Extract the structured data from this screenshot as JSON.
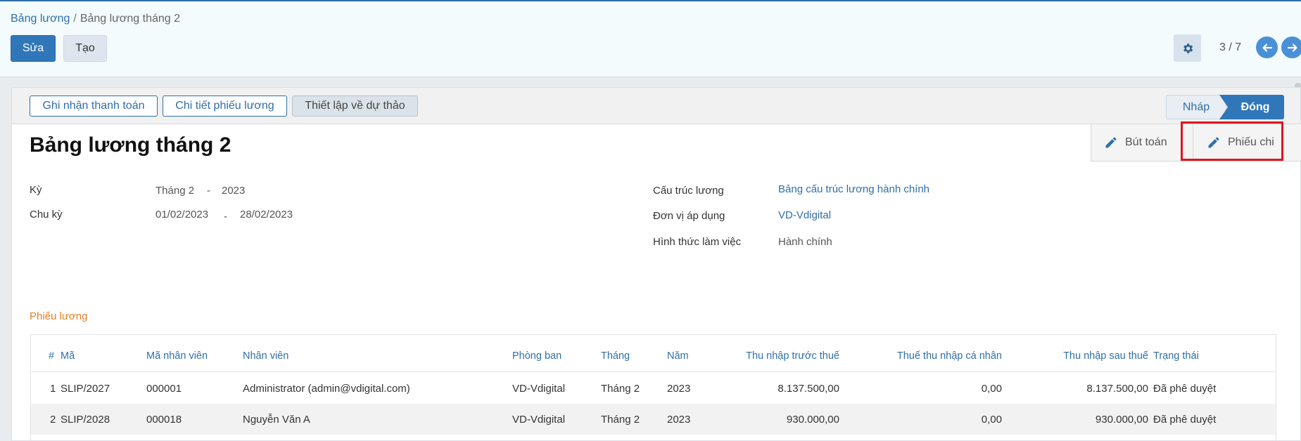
{
  "breadcrumb": {
    "parent": "Bảng lương",
    "separator": "/",
    "current": "Bảng lương tháng 2"
  },
  "actions": {
    "edit": "Sửa",
    "create": "Tạo"
  },
  "pager": {
    "text": "3 / 7"
  },
  "status_buttons": {
    "record_payment": "Ghi nhận thanh toán",
    "slip_details": "Chi tiết phiếu lương",
    "set_draft": "Thiết lập về dự thảo"
  },
  "stages": {
    "draft": "Nháp",
    "done": "Đóng",
    "active": "done"
  },
  "smart_buttons": {
    "journal": "Bút toán",
    "payment_voucher": "Phiếu chi"
  },
  "form": {
    "title": "Bảng lương tháng 2",
    "period_label": "Kỳ",
    "period_month": "Tháng 2",
    "period_dash": "-",
    "period_year": "2023",
    "cycle_label": "Chu kỳ",
    "cycle_from": "01/02/2023",
    "cycle_dash": "-",
    "cycle_to": "28/02/2023",
    "structure_label": "Cấu trúc lương",
    "structure_value": "Bảng cấu trúc lương hành chính",
    "unit_label": "Đơn vị áp dụng",
    "unit_value": "VD-Vdigital",
    "work_type_label": "Hình thức làm việc",
    "work_type_value": "Hành chính"
  },
  "slips": {
    "section_title": "Phiếu lương",
    "columns": {
      "index": "#",
      "code": "Mã",
      "employee_code": "Mã nhân viên",
      "employee": "Nhân viên",
      "department": "Phòng ban",
      "month": "Tháng",
      "year": "Năm",
      "gross": "Thu nhập trước thuế",
      "tax": "Thuế thu nhập cá nhân",
      "net": "Thu nhập sau thuế",
      "status": "Trạng thái"
    },
    "rows": [
      {
        "index": "1",
        "code": "SLIP/2027",
        "employee_code": "000001",
        "employee": "Administrator (admin@vdigital.com)",
        "department": "VD-Vdigital",
        "month": "Tháng 2",
        "year": "2023",
        "gross": "8.137.500,00",
        "tax": "0,00",
        "net": "8.137.500,00",
        "status": "Đã phê duyệt"
      },
      {
        "index": "2",
        "code": "SLIP/2028",
        "employee_code": "000018",
        "employee": "Nguyễn Văn A",
        "department": "VD-Vdigital",
        "month": "Tháng 2",
        "year": "2023",
        "gross": "930.000,00",
        "tax": "0,00",
        "net": "930.000,00",
        "status": "Đã phê duyệt"
      }
    ]
  },
  "icons": {
    "settings": "gear-icon",
    "prev": "arrow-left-icon",
    "next": "arrow-right-icon",
    "journal": "pencil-icon",
    "payment_voucher": "pencil-icon"
  },
  "colors": {
    "primary": "#2f77b8",
    "link": "#2f6fa8",
    "section": "#e0822a",
    "highlight": "#e0141f"
  }
}
